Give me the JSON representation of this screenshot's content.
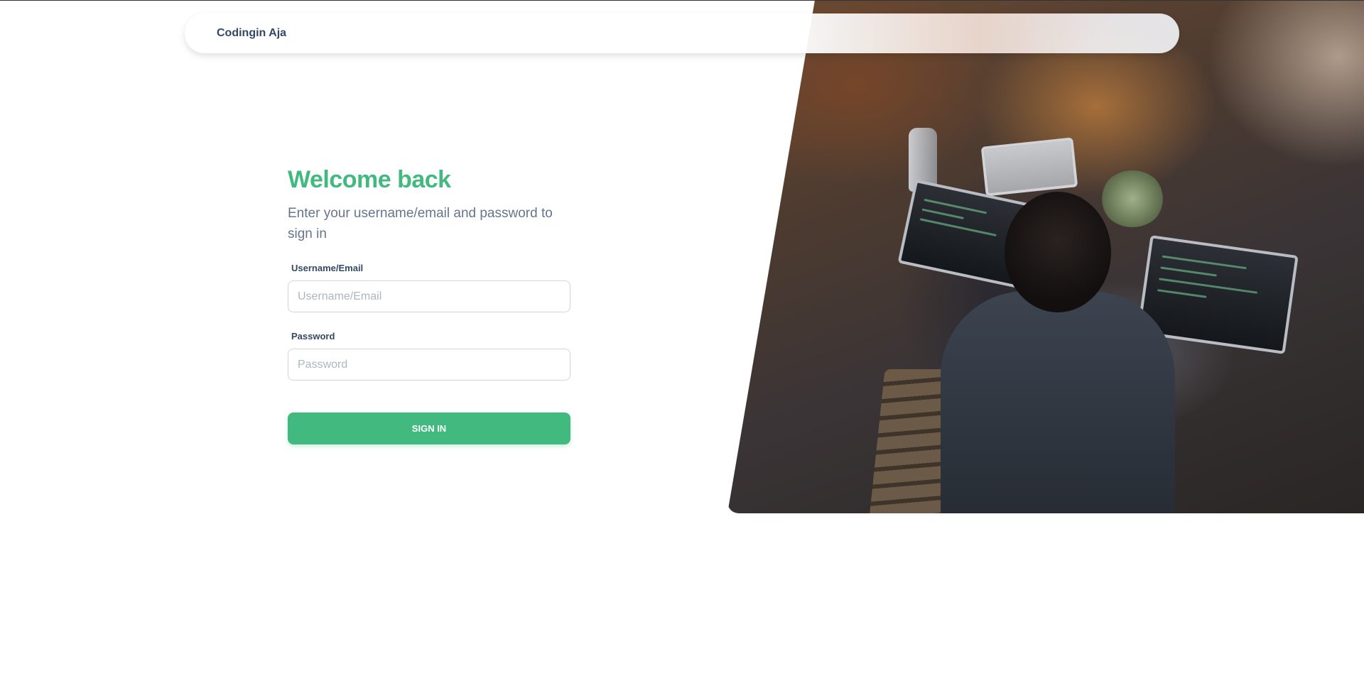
{
  "navbar": {
    "brand": "Codingin Aja"
  },
  "signin": {
    "title": "Welcome back",
    "subtitle": "Enter your username/email and password to sign in",
    "username": {
      "label": "Username/Email",
      "placeholder": "Username/Email",
      "value": ""
    },
    "password": {
      "label": "Password",
      "placeholder": "Password",
      "value": ""
    },
    "submit_label": "SIGN IN"
  },
  "colors": {
    "accent": "#42ba7f",
    "heading_text": "#344767",
    "muted_text": "#67748e"
  }
}
